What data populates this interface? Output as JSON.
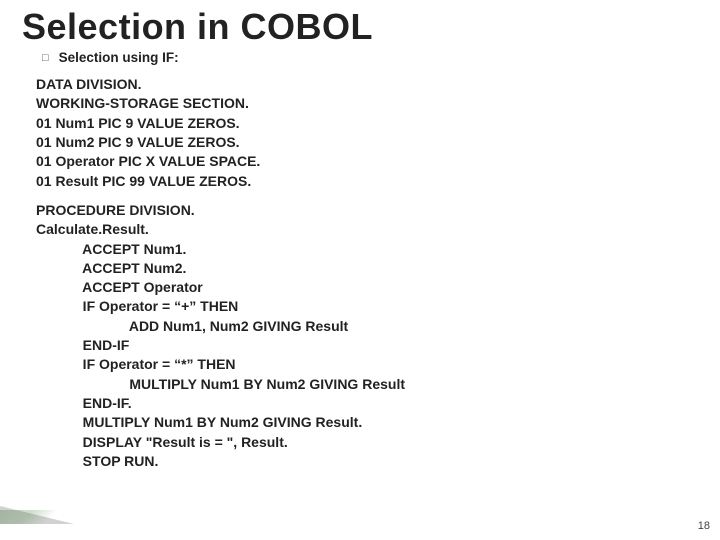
{
  "title": "Selection in COBOL",
  "subtitle": "Selection using IF:",
  "code_block1": "DATA DIVISION.\nWORKING-STORAGE SECTION.\n01 Num1 PIC 9 VALUE ZEROS.\n01 Num2 PIC 9 VALUE ZEROS.\n01 Operator PIC X VALUE SPACE.\n01 Result PIC 99 VALUE ZEROS.",
  "code_block2": "PROCEDURE DIVISION.\nCalculate.Result.\n            ACCEPT Num1.\n            ACCEPT Num2.\n            ACCEPT Operator\n            IF Operator = “+” THEN\n                        ADD Num1, Num2 GIVING Result\n            END-IF\n            IF Operator = “*” THEN\n                        MULTIPLY Num1 BY Num2 GIVING Result\n            END-IF.\n            MULTIPLY Num1 BY Num2 GIVING Result.\n            DISPLAY \"Result is = \", Result.\n            STOP RUN.",
  "page_number": "18"
}
